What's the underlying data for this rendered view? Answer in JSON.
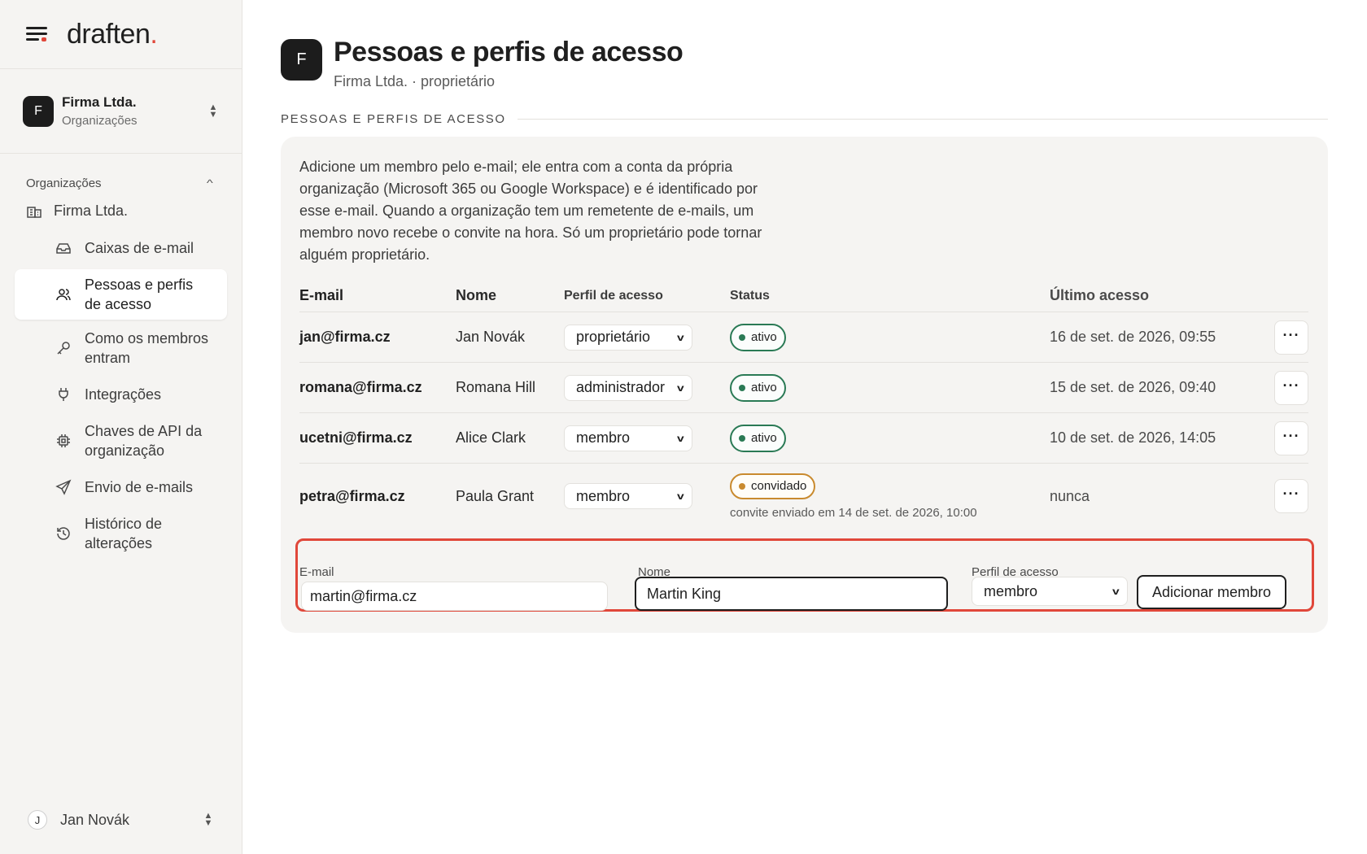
{
  "brand": {
    "name": "draften",
    "dot": "."
  },
  "org_switcher": {
    "avatar": "F",
    "name": "Firma Ltda.",
    "sub": "Organizações"
  },
  "sidebar": {
    "section_title": "Organizações",
    "org_label": "Firma Ltda.",
    "items": [
      {
        "label": "Caixas de e-mail",
        "icon": "inbox-icon"
      },
      {
        "label": "Pessoas e perfis de acesso",
        "icon": "users-icon",
        "active": true
      },
      {
        "label": "Como os membros entram",
        "icon": "key-icon"
      },
      {
        "label": "Integrações",
        "icon": "plug-icon"
      },
      {
        "label": "Chaves de API da organização",
        "icon": "cpu-icon"
      },
      {
        "label": "Envio de e-mails",
        "icon": "send-icon"
      },
      {
        "label": "Histórico de alterações",
        "icon": "history-icon"
      }
    ]
  },
  "user": {
    "avatar": "J",
    "name": "Jan Novák"
  },
  "header": {
    "avatar": "F",
    "title": "Pessoas e perfis de acesso",
    "subtitle": "Firma Ltda. · proprietário"
  },
  "section": {
    "eyebrow": "PESSOAS E PERFIS DE ACESSO"
  },
  "intro": "Adicione um membro pelo e-mail; ele entra com a conta da própria organização (Microsoft 365 ou Google Workspace) e é identificado por esse e-mail. Quando a organização tem um remetente de e-mails, um membro novo recebe o convite na hora. Só um proprietário pode tornar alguém proprietário.",
  "table": {
    "columns": [
      "E-mail",
      "Nome",
      "Perfil de acesso",
      "Status",
      "Último acesso"
    ],
    "rows": [
      {
        "email": "jan@firma.cz",
        "name": "Jan Novák",
        "role": "proprietário",
        "status": "ativo",
        "last": "16 de set. de 2026, 09:55"
      },
      {
        "email": "romana@firma.cz",
        "name": "Romana Hill",
        "role": "administrador",
        "status": "ativo",
        "last": "15 de set. de 2026, 09:40"
      },
      {
        "email": "ucetni@firma.cz",
        "name": "Alice Clark",
        "role": "membro",
        "status": "ativo",
        "last": "10 de set. de 2026, 14:05"
      },
      {
        "email": "petra@firma.cz",
        "name": "Paula Grant",
        "role": "membro",
        "status": "convidado",
        "note": "convite enviado em 14 de set. de 2026, 10:00",
        "last": "nunca"
      }
    ],
    "more_label": "···"
  },
  "add_form": {
    "email_label": "E-mail",
    "email_value": "martin@firma.cz",
    "name_label": "Nome",
    "name_value": "Martin King",
    "role_label": "Perfil de acesso",
    "role_value": "membro",
    "submit": "Adicionar membro"
  },
  "colors": {
    "accent": "#e0473a",
    "active_status": "#2a7a55",
    "invited_status": "#c98a2e"
  }
}
